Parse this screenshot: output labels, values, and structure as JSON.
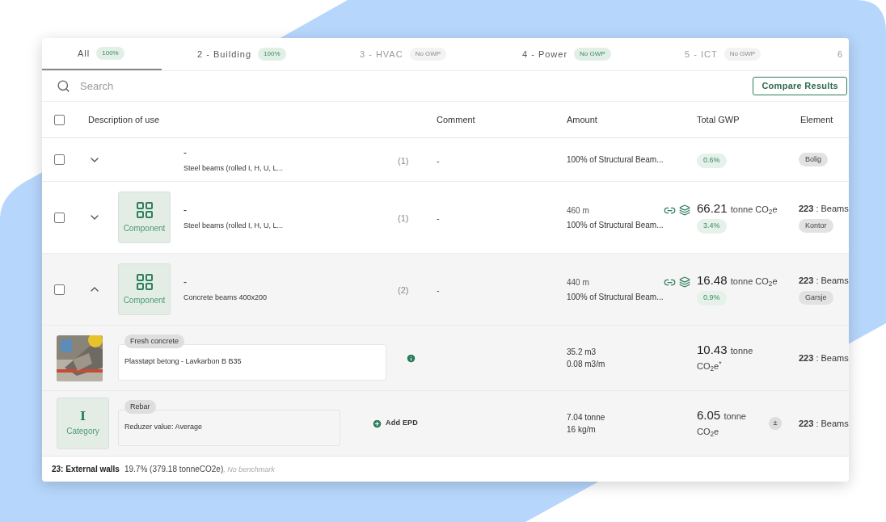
{
  "tabs": [
    {
      "label": "All",
      "badge": "100%",
      "selected": true,
      "disabled": false
    },
    {
      "label": "2 - Building",
      "badge": "100%",
      "selected": false,
      "disabled": false
    },
    {
      "label": "3 - HVAC",
      "badge": "No GWP",
      "selected": false,
      "disabled": true
    },
    {
      "label": "4 - Power",
      "badge": "No GWP",
      "selected": false,
      "disabled": false
    },
    {
      "label": "5 - ICT",
      "badge": "No GWP",
      "selected": false,
      "disabled": true
    },
    {
      "label": "6",
      "selected": false,
      "disabled": true
    }
  ],
  "search": {
    "placeholder": "Search"
  },
  "compare_button": "Compare Results",
  "table": {
    "columns": [
      "Description of use",
      "Comment",
      "Amount",
      "Total GWP",
      "Element"
    ],
    "select_all": {
      "checked": false
    },
    "rows": [
      {
        "kind": "component",
        "cut": true,
        "checked": false,
        "expanded": false,
        "title": "-",
        "description": "Steel beams (rolled I, H, U, L...",
        "count": "(1)",
        "comment": "-",
        "amount_note": "100% of Structural Beam...",
        "share": "0.6%",
        "tag": "Bolig"
      },
      {
        "kind": "component",
        "cut": false,
        "checked": false,
        "expanded": false,
        "tile_label": "Component",
        "title": "-",
        "description": "Steel beams (rolled I, H, U, L...",
        "count": "(1)",
        "comment": "-",
        "amount": "460 m",
        "amount_note": "100% of Structural Beam...",
        "gwp": "66.21",
        "gwp_unit": "tonne CO$_{2}$e",
        "share": "3.4%",
        "element_code": "223",
        "element_name": ": Beams",
        "tag": "Kontor"
      },
      {
        "kind": "component",
        "cut": false,
        "checked": false,
        "expanded": true,
        "tile_label": "Component",
        "title": "-",
        "description": "Concrete beams 400x200",
        "count": "(2)",
        "comment": "-",
        "amount": "440 m",
        "amount_note": "100% of Structural Beam...",
        "gwp": "16.48",
        "gwp_unit": "tonne CO$_{2}$e",
        "share": "0.9%",
        "element_code": "223",
        "element_name": ": Beams",
        "tag": "Garsje"
      },
      {
        "kind": "product",
        "tag": "Fresh concrete",
        "value": "Plasstøpt betong - Lavkarbon B B35",
        "amount": "35.2 m3",
        "amount_note": "0.08 m3/m",
        "gwp": "10.43",
        "gwp_unit": "tonne CO$_{2}$e$^{*}$",
        "element_code": "223",
        "element_name": ": Beams"
      },
      {
        "kind": "category",
        "tile_icon": "I",
        "tile_label": "Category",
        "tag": "Rebar",
        "value": "Reduzer value: Average",
        "action": "Add EPD",
        "amount": "7.04 tonne",
        "amount_note": "16 kg/m",
        "gwp": "6.05",
        "gwp_unit": "tonne CO$_{2}$e",
        "range_button": "±",
        "element_code": "223",
        "element_name": ": Beams"
      }
    ]
  },
  "footer": {
    "group": "23: External walls",
    "summary": "19.7% (379.18 tonneCO2e)",
    "benchmark": ", No benchmark"
  }
}
